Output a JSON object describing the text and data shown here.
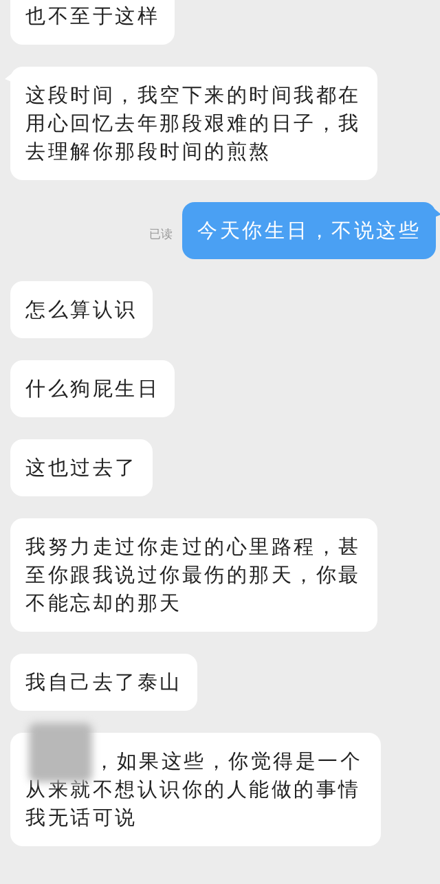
{
  "messages": [
    {
      "kind": "received",
      "text": "也不至于这样",
      "tail": false
    },
    {
      "kind": "received",
      "text": "这段时间，我空下来的时间我都在用心回忆去年那段艰难的日子，我去理解你那段时间的煎熬",
      "tail": true
    },
    {
      "kind": "sent",
      "text": "今天你生日，不说这些",
      "tail": true,
      "receipt": "已读"
    },
    {
      "kind": "received",
      "text": "怎么算认识",
      "tail": false
    },
    {
      "kind": "received",
      "text": "什么狗屁生日",
      "tail": false
    },
    {
      "kind": "received",
      "text": "这也过去了",
      "tail": false
    },
    {
      "kind": "received",
      "text": "我努力走过你走过的心里路程，甚至你跟我说过你最伤的那天，你最不能忘却的那天",
      "tail": false
    },
    {
      "kind": "received",
      "text": "我自己去了泰山",
      "tail": false
    },
    {
      "kind": "received",
      "text": "，如果这些，你觉得是一个从来就不想认识你的人能做的事情我无话可说",
      "tail": false,
      "redacted": true
    }
  ]
}
